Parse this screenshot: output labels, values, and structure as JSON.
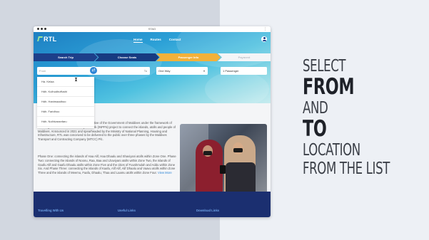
{
  "window": {
    "title": "STAG"
  },
  "navbar": {
    "logo": "RTL",
    "links": [
      {
        "label": "Home",
        "active": true
      },
      {
        "label": "Routes",
        "active": false
      },
      {
        "label": "Contact",
        "active": false
      }
    ]
  },
  "steps": [
    {
      "label": "Search Trip",
      "state": "done"
    },
    {
      "label": "Choose Seats",
      "state": "done"
    },
    {
      "label": "Passenger Info",
      "state": "current"
    },
    {
      "label": "Payment",
      "state": "pending"
    }
  ],
  "search": {
    "from_placeholder": "From",
    "to_placeholder": "To",
    "trip_type": "One Way",
    "passengers": "1 Passenger"
  },
  "dropdown": {
    "items": [
      "Ha. Kelaa",
      "Hdh. Kulhudhuffushi",
      "Hdh. Hanimaadhoo",
      "Hdh. Faridhoo",
      "Hdh. Nolhivaranfaru"
    ]
  },
  "content": {
    "para1": "The Route Transport Link (RTL) is an initiative of the Government of Maldives under the framework of the Integrated National Public Ferry Network (INPFN) project to connect the islands, atolls and people of Maldives. Announced in 2021 and spearheaded by the Ministry of National Planning, Housing and Infrastructure, RTL was conceived to be delivered to the public over three phases by the Maldives Transport and Contracting Company (MTCC) Plc.",
    "para2": "Phase One: connecting the islands of Haa Alif, Haa Dhaalu and Shaviyani atolls within Zone One. Phase Two: connecting the islands of Noonu, Raa, Baa and Lhaviyani atolls within Zone Two, the islands of Gaafu Alif and Gaafu Dhaalu atolls within Zone Five and the cities of Fuvahmulah and Addu within Zone Six. And Phase Three: connecting the islands of Kaafu, Alif Alif, Alif Dhaalu and Vaavu atolls within Zone Three and the islands of Meemu, Faafu, Dhaalu, Thaa and Laamu atolls within Zone Four.",
    "more": "View More"
  },
  "footer": {
    "links": [
      "Travelling With Us",
      "Useful Links",
      "Download Links"
    ]
  },
  "caption": {
    "lines": [
      "SELECT",
      "FROM",
      "AND",
      "TO",
      "LOCATION",
      "FROM THE LIST"
    ]
  },
  "colors": {
    "navy": "#1d3f8a",
    "accent": "#f2b13a",
    "footer": "#1b2f70",
    "link": "#2f86d6"
  }
}
